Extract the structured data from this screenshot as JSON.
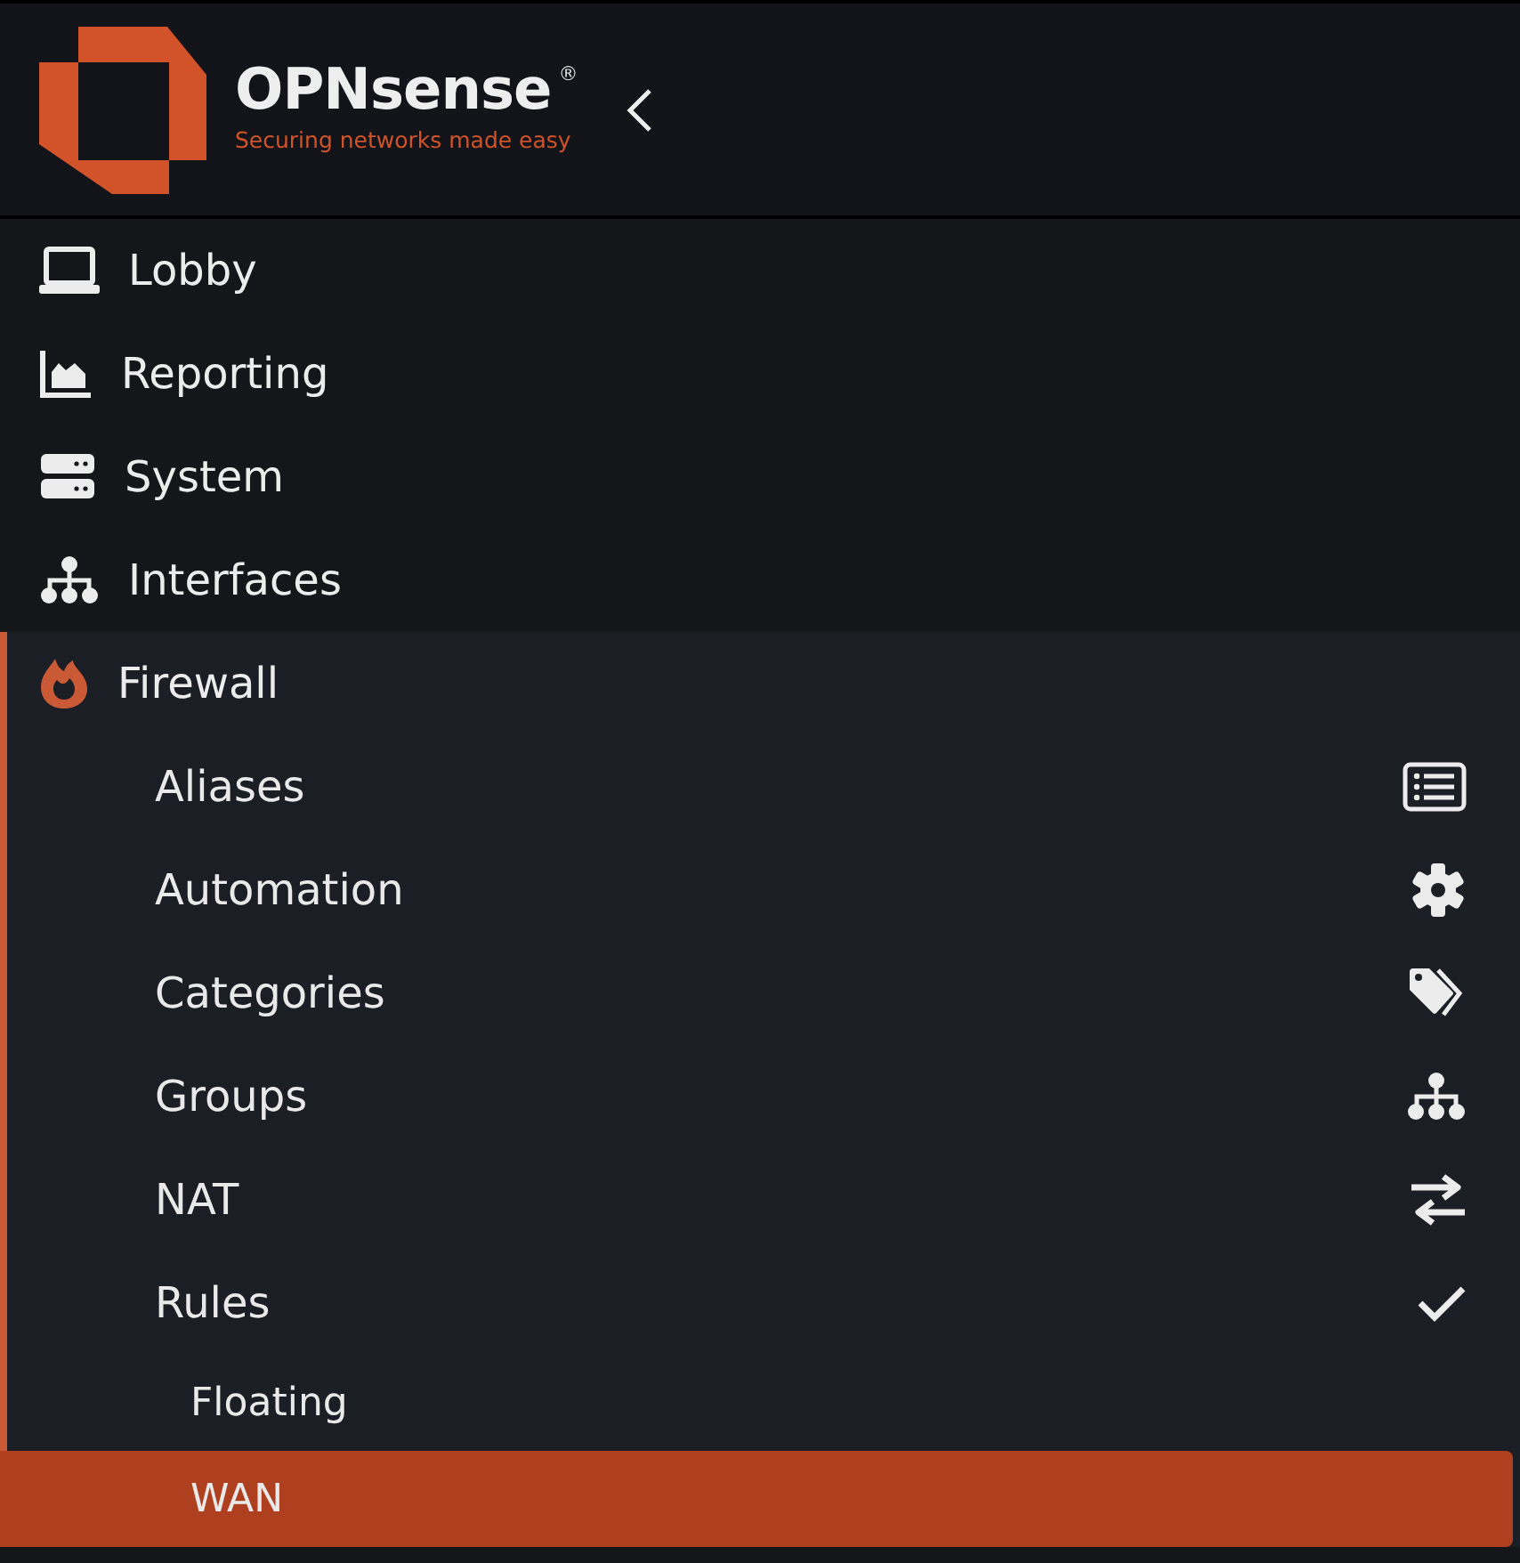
{
  "brand": {
    "name": "OPNsense",
    "registered": "®",
    "tagline": "Securing networks made easy"
  },
  "menu": [
    {
      "label": "Lobby",
      "selected": false
    },
    {
      "label": "Reporting",
      "selected": false
    },
    {
      "label": "System",
      "selected": false
    },
    {
      "label": "Interfaces",
      "selected": false
    },
    {
      "label": "Firewall",
      "selected": false,
      "expanded": true,
      "children": [
        {
          "label": "Aliases",
          "selected": false
        },
        {
          "label": "Automation",
          "selected": false
        },
        {
          "label": "Categories",
          "selected": false
        },
        {
          "label": "Groups",
          "selected": false
        },
        {
          "label": "NAT",
          "selected": false
        },
        {
          "label": "Rules",
          "selected": false,
          "expanded": true,
          "children": [
            {
              "label": "Floating",
              "selected": false
            },
            {
              "label": "WAN",
              "selected": true
            }
          ]
        }
      ]
    }
  ]
}
